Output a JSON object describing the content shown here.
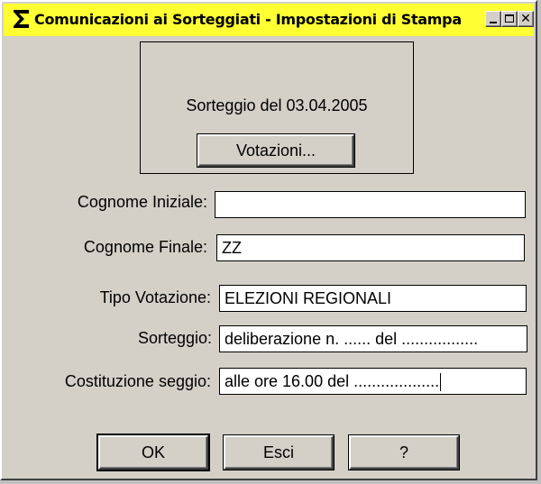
{
  "window": {
    "title": "Comunicazioni ai Sorteggiati - Impostazioni di Stampa",
    "app_icon": "s-logo-icon",
    "controls": {
      "minimize": "minimize-icon",
      "maximize": "maximize-icon",
      "close": "close-icon",
      "close_glyph": "✕"
    },
    "title_bar_color": "#ffff33"
  },
  "draw": {
    "label": "Sorteggio del 03.04.2005",
    "votazioni_button": "Votazioni..."
  },
  "fields": {
    "cognome_iniziale": {
      "label": "Cognome Iniziale:",
      "value": ""
    },
    "cognome_finale": {
      "label": "Cognome Finale:",
      "value": "ZZ"
    },
    "tipo_votazione": {
      "label": "Tipo Votazione:",
      "value": "ELEZIONI REGIONALI"
    },
    "sorteggio": {
      "label": "Sorteggio:",
      "value": "deliberazione n. ...... del ................."
    },
    "costituzione_seggio": {
      "label": "Costituzione seggio:",
      "value": "alle ore 16.00 del ..................."
    }
  },
  "buttons": {
    "ok": "OK",
    "esci": "Esci",
    "help": "?"
  }
}
